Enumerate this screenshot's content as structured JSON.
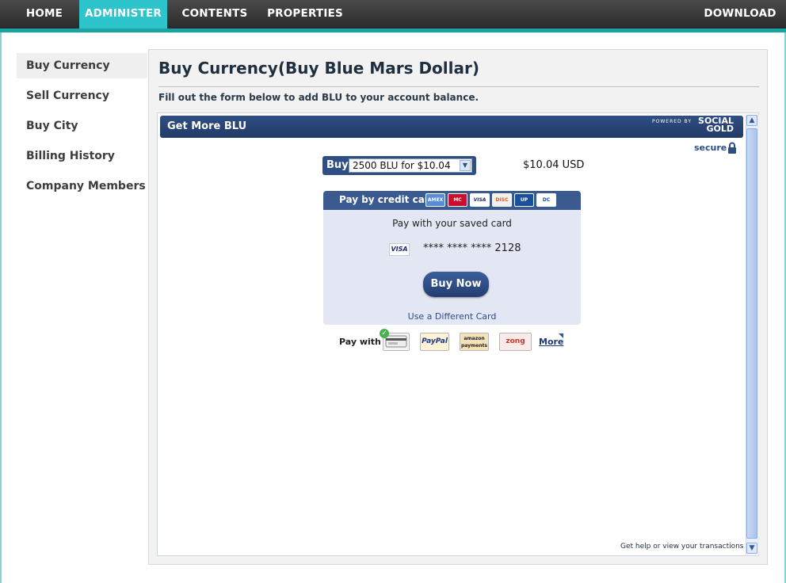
{
  "nav": {
    "home": "HOME",
    "administer": "ADMINISTER",
    "contents": "CONTENTS",
    "properties": "PROPERTIES",
    "download": "DOWNLOAD"
  },
  "sidebar": {
    "items": [
      {
        "label": "Buy Currency",
        "active": true
      },
      {
        "label": "Sell Currency"
      },
      {
        "label": "Buy City"
      },
      {
        "label": "Billing History"
      },
      {
        "label": "Company Members"
      }
    ]
  },
  "main": {
    "title": "Buy Currency(Buy Blue Mars Dollar)",
    "subtitle": "Fill out the form below to add BLU to your account balance."
  },
  "widget": {
    "title": "Get More BLU",
    "powered_by": "POWERED BY",
    "brand_line1": "SOCIAL",
    "brand_line2": "GOLD",
    "secure": "secure",
    "buy_label": "Buy",
    "selected_option": "2500 BLU for $10.04",
    "price": "$10.04 USD",
    "cc_title": "Pay by credit card",
    "card_logos": [
      "AMEX",
      "MC",
      "VISA",
      "DISC",
      "UP",
      "DC"
    ],
    "saved_text": "Pay with your saved card",
    "saved_card_brand": "VISA",
    "card_number": "**** **** **** 2128",
    "buy_now": "Buy Now",
    "different_card": "Use a Different Card",
    "pay_with": "Pay with",
    "pay_options": [
      "",
      "PayPal",
      "amazon payments",
      "zong"
    ],
    "more": "More",
    "help": "Get help or view your transactions"
  },
  "colors": {
    "accent_teal": "#2ec4cc",
    "header_blue": "#2f4f84"
  }
}
